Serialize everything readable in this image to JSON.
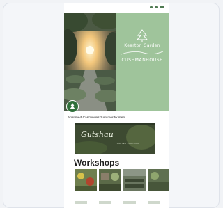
{
  "brand": {
    "line1": "Kearton Garden",
    "line2": "CUSHMANHOUSE"
  },
  "tagline": "Arial med Casmindes zum mordikelten",
  "banner": {
    "script": "Gutshau",
    "sub": "GARTEN · GUTSHOF"
  },
  "section": {
    "workshops_title": "Workshops"
  },
  "workshops": [
    {
      "title": "",
      "date": ""
    },
    {
      "title": "",
      "date": ""
    },
    {
      "title": "",
      "date": ""
    },
    {
      "title": "",
      "date": ""
    }
  ],
  "colors": {
    "brand_green": "#9fc49b",
    "fab_green": "#2f6f3a",
    "banner_bg": "#3d4a31"
  },
  "icons": {
    "status": [
      "signal-icon",
      "wifi-icon",
      "battery-icon"
    ],
    "logo": "tree-logo-icon",
    "fab": "leaf-icon"
  }
}
